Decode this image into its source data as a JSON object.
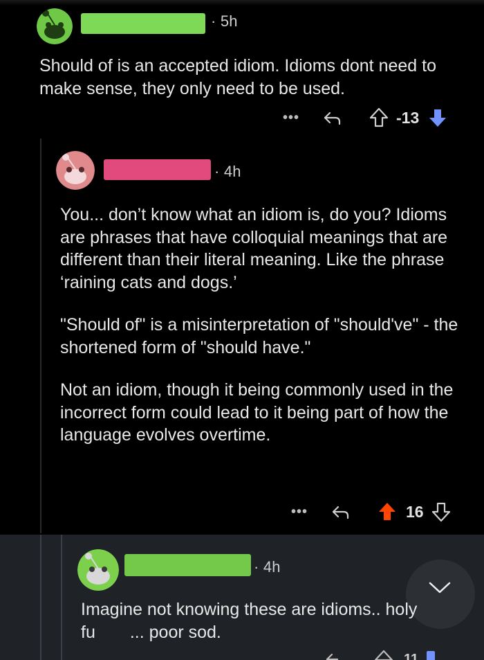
{
  "comments": [
    {
      "time": "· 5h",
      "text": [
        "Should of is an accepted idiom. Idioms dont need to make sense, they only need to be used."
      ],
      "actions": {
        "more": "•••",
        "score": "-13",
        "vote": "downvoted"
      },
      "colors": {
        "avatar": "#6fc947",
        "redact": "#7ed957",
        "vote_accent": "#7193ff"
      }
    },
    {
      "time": "· 4h",
      "text": [
        "You... don’t know what an idiom is, do you? Idioms are phrases that have colloquial meanings that are different than their literal meaning. Like the phrase ‘raining cats and dogs.’",
        "\"Should of\" is a misinterpretation of \"should've\" - the shortened form of \"should have.\"",
        "Not an idiom, though it being commonly used in the incorrect form could lead to it being part of how the language evolves overtime."
      ],
      "actions": {
        "more": "•••",
        "score": "16",
        "vote": "upvoted"
      },
      "colors": {
        "avatar": "#e08a8d",
        "redact": "#e24a7d",
        "vote_accent": "#ff4500"
      }
    },
    {
      "time": "· 4h",
      "text": [
        "Imagine not knowing these are idioms.. holy fu  ... poor sod."
      ],
      "actions": {
        "score": "11"
      },
      "colors": {
        "avatar": "#7cd04c",
        "redact": "#74c94a"
      }
    }
  ],
  "icons": {
    "avatar": "snoo-avatar-icon",
    "reply": "reply-arrow-icon",
    "upvote": "upvote-arrow-icon",
    "downvote": "downvote-arrow-icon",
    "collapse": "chevron-down-icon"
  }
}
